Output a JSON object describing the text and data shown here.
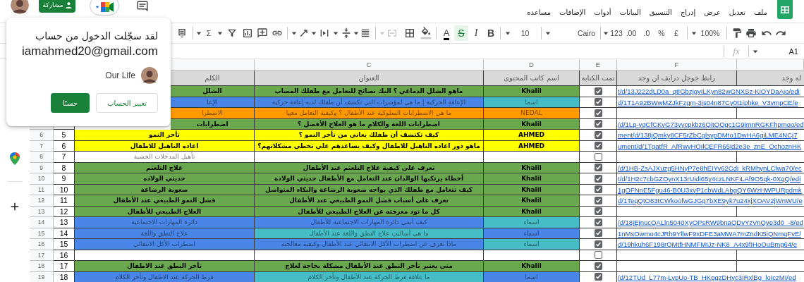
{
  "top_bar": {
    "share_label": "مشاركة",
    "menu": [
      "ملف",
      "تعديل",
      "عرض",
      "إدراج",
      "التنسيق",
      "البيانات",
      "أدوات",
      "الإضافات",
      "مساعده"
    ]
  },
  "toolbar": {
    "zoom": "100%",
    "currency": "£",
    "percent": "%",
    "decimals_decrease": ".0",
    "decimals_increase": ".00",
    "number_format": "123",
    "font": "Cairo",
    "font_size": "10",
    "functions": "Σ",
    "format_buttons": [
      {
        "label": "B",
        "kind": "bold",
        "selected": false
      },
      {
        "label": "I",
        "kind": "italic",
        "selected": false
      },
      {
        "label": "S",
        "kind": "strikethrough",
        "selected": true
      },
      {
        "label": "A",
        "kind": "text_color",
        "selected": false
      }
    ]
  },
  "formula_bar": {
    "cell": "A1",
    "fx": "fx"
  },
  "sheet": {
    "column_letters": [
      "F",
      "E",
      "D",
      "C"
    ],
    "header": {
      "keyword": "الكلم",
      "title": "العنوان",
      "author": "اسم كاتب المحتوى",
      "done": "تمت الكتابة",
      "drive_link": "رابط جوجل درايف ان وجد",
      "column_7": "لة وجد"
    },
    "rows": [
      {
        "keyword": {
          "text": "الشلل",
          "color": "#6aa84f"
        },
        "title": {
          "text": "ماهو الشلل الدماغي ؟ اليك نصائح للتعامل مع طفلك المصاب",
          "color": "#6aa84f"
        },
        "author": {
          "text": "Khalil",
          "color": "#6aa84f"
        },
        "bold": true,
        "checked": true,
        "link": "t/d/13J222dLD0a_qtIGbzjgyILKyn82wGNXSz-KiOYDaAjo/edi"
      },
      {
        "keyword": {
          "text": "الإعا",
          "color": "#4a86e8"
        },
        "title": {
          "text": "الإعاقة الحركية | ما هي لمؤشرات التي تكشف أن طفلك لديه إعاقة حركية",
          "color": "#4a86e8"
        },
        "author": {
          "text": "اسما",
          "color": "#46bdc6"
        },
        "bold": false,
        "checked": true,
        "link": "d/1T1A92BWwMZJkFzgm-3js04n87Cy0t1iphke_V3vmpCE/e"
      },
      {
        "keyword": {
          "text": "الاضطرا",
          "color": "#ff9900"
        },
        "title": {
          "text": "ما هي الاضطرابات السلوكية عند الأطفال ؟ وكيفية التعامل معها",
          "color": "#ff9900"
        },
        "author": {
          "text": "NEDAL",
          "color": "#ff9900"
        },
        "bold": false,
        "checked": true
      },
      {
        "keyword": {
          "text": "اضطرابات",
          "color": "#6aa84f"
        },
        "title": {
          "text": "اضطرابات اللغة والكلام ما هو العلاج الأفضل ؟",
          "color": "#6aa84f"
        },
        "author": {
          "text": "Khalil",
          "color": "#6aa84f"
        },
        "bold": true,
        "checked": true,
        "link": "/d/1Lp-yqCfCKyG73yycpkbz6QitQQgc1G9jmnRGKFhpmqo/ed"
      },
      {
        "row_number": "6",
        "number": "5",
        "keyword": {
          "text": "تأخر النمو",
          "color": "#ffff00"
        },
        "title": {
          "text": "كيف تكتشف أن طفلك يعاني من تأخر النمو ؟",
          "color": "#ffff00"
        },
        "author": {
          "text": "AHMED",
          "color": "#ffff00"
        },
        "bold": true,
        "checked": true,
        "link": "ment/d/138jQmky8CF5rZbCglsypDMto1DwHA6giLME4NCj7"
      },
      {
        "row_number": "7",
        "number": "6",
        "keyword": {
          "text": "اعاده التاهيل للاطفال",
          "color": "#ffff00"
        },
        "title": {
          "text": "ماهو دور اعاده التاهيل للاطفال وكيف يساعدهم على تخطى مشكلاتهم؟",
          "color": "#ffff00"
        },
        "author": {
          "text": "AHMED",
          "color": "#ffff00"
        },
        "bold": true,
        "checked": true,
        "link": "ument/d/1TgatfR_AfRwyHOIlCEFR65id2e3e_znE_OchoznHK"
      },
      {
        "row_number": "8",
        "number": "7",
        "keyword": {
          "text": "تأهيل المدخلات الحسية",
          "color": "#ffffff"
        },
        "title": {
          "color": "#ffffff"
        },
        "author": {
          "color": "#ffffff"
        },
        "bold": false,
        "checked": false
      },
      {
        "row_number": "9",
        "number": "8",
        "keyword": {
          "text": "علاج التلعثم",
          "color": "#6aa84f"
        },
        "title": {
          "text": "تعرف على كيفية علاج التلعثم عند الأطفال",
          "color": "#6aa84f"
        },
        "author": {
          "text": "Khalil",
          "color": "#6aa84f"
        },
        "bold": true,
        "checked": true,
        "link": "/d/1HB-ZsAJXuzg5HNyP7e8hEIYv62Cdj_kRMhynLClwa70/ec"
      },
      {
        "row_number": "10",
        "number": "9",
        "keyword": {
          "text": "حديثي الولاده",
          "color": "#6aa84f"
        },
        "title": {
          "text": "أخطاء يرتكبها الوالدان عند التعامل مع الأطفال حديثي الولادة",
          "color": "#6aa84f"
        },
        "author": {
          "text": "Khalil",
          "color": "#6aa84f"
        },
        "bold": true,
        "checked": true,
        "link": "t/d/1H2c7cbGZOynX13rUidi65y4czLNKFiLAf9O5qk-0XqQ/edi"
      },
      {
        "row_number": "11",
        "number": "10",
        "keyword": {
          "text": "صعوبة الرضاعة",
          "color": "#6aa84f"
        },
        "title": {
          "text": "كيف تتعامل مع طفلك الذي يواجه صعوبة الرضاعة والبكاء المتواصل",
          "color": "#6aa84f"
        },
        "author": {
          "text": "Khalil",
          "color": "#6aa84f"
        },
        "bold": true,
        "checked": true,
        "link": "1gOFNnE5Fgu46-B0U3xyP1cbWdLAbgQY6WzHWPURpdmk"
      },
      {
        "row_number": "12",
        "number": "11",
        "keyword": {
          "text": "فشل النمو الطبيعي عند الأطفال",
          "color": "#6aa84f"
        },
        "title": {
          "text": "تعرف على أسباب فشل النمو الطبيعي عند الأطفال",
          "color": "#6aa84f"
        },
        "author": {
          "text": "Khalil",
          "color": "#6aa84f"
        },
        "bold": true,
        "checked": true,
        "link": "d/1TeqQtO83tCWkoofwGJGg7bXE9yk7u24xjXOAV2jWnWU/e"
      },
      {
        "row_number": "13",
        "number": "12",
        "keyword": {
          "text": "العلاج الطبيعي للأطفال",
          "color": "#6aa84f"
        },
        "title": {
          "text": "كل ما تود معرفته عن العلاج الطبيعي للأطفال",
          "color": "#6aa84f"
        },
        "author": {
          "text": "Khalil",
          "color": "#6aa84f"
        },
        "bold": true,
        "checked": true
      },
      {
        "row_number": "14",
        "number": "13",
        "keyword": {
          "text": "دائرة المهارات الاجتماعية",
          "color": "#4a86e8"
        },
        "title": {
          "text": "كيف أنمي دائرة المهارات الاجتماعية للأطفال",
          "color": "#4a86e8"
        },
        "author": {
          "text": "اسماء",
          "color": "#46bdc6"
        },
        "bold": false,
        "checked": true,
        "link": "/d/18jEjnucQALln5040XyOPsRW9bnaQDvYzVnQve3d0_-8/ed"
      },
      {
        "row_number": "15",
        "number": "14",
        "keyword": {
          "text": "علاج النطق واللغة",
          "color": "#4a86e8"
        },
        "title": {
          "text": "ما هي أساليب علاج النطق واللغة  عند الأطفال",
          "color": "#46bdc6"
        },
        "author": {
          "text": "اسماء",
          "color": "#4a86e8"
        },
        "bold": false,
        "checked": true,
        "link": "1nMsOwmo4cJRh9YllwF9xDFE3aMWA7mZndKBiQNmqFvE/"
      },
      {
        "row_number": "16",
        "number": "15",
        "keyword": {
          "text": "اضطراب الأكل الانتقائي",
          "color": "#4a86e8"
        },
        "title": {
          "text": "ماذا تعرف عن اضطراب الأكل الانتقائي عند الأطفال وكيفية معالجته",
          "color": "#4a86e8"
        },
        "author": {
          "text": "اسماء",
          "color": "#46bdc6"
        },
        "bold": false,
        "checked": true,
        "link": "d/19hkuh6F198rQMtfHNMFMIJz-NK8_A4x9fIHoOuBmg64/e"
      },
      {
        "row_number": "17",
        "number": "16",
        "keyword": {
          "color": "#ffffff"
        },
        "title": {
          "color": "#ffffff"
        },
        "author": {
          "color": "#ffffff"
        },
        "checked": false
      },
      {
        "row_number": "18",
        "number": "17",
        "keyword": {
          "text": "تأخر النطق عند الاطفال",
          "color": "#6aa84f"
        },
        "title": {
          "text": "متى يعتبر تأخر النطق عند الأطفال مشكلة بحاجة لعلاج",
          "color": "#6aa84f"
        },
        "author": {
          "text": "Khalil",
          "color": "#6aa84f"
        },
        "bold": true,
        "checked": true
      },
      {
        "row_number": "19",
        "number": "18",
        "keyword": {
          "text": "فرط الحركة عند الاطفال وتأخر الكلام",
          "color": "#4a86e8"
        },
        "title": {
          "text": "ما علاقة فرط الحركة عند الأطفال وتأخر الكلام",
          "color": "#46bdc6"
        },
        "author": {
          "text": "اسما",
          "color": "#4a86e8"
        },
        "bold": false,
        "checked": true,
        "link": "/d/12TUd_L77m-LypUo-TB_HKpgzDHyc3IRxlBg_loIczMI/ed"
      }
    ]
  },
  "account_popup": {
    "message": "لقد سجّلت الدخول من حساب",
    "email": "iamahmed20@gmail.com",
    "profile_name": "Our Life",
    "buttons": [
      {
        "label": "تغيير الحساب",
        "kind": "secondary"
      },
      {
        "label": "حسنًا",
        "kind": "primary"
      }
    ]
  }
}
